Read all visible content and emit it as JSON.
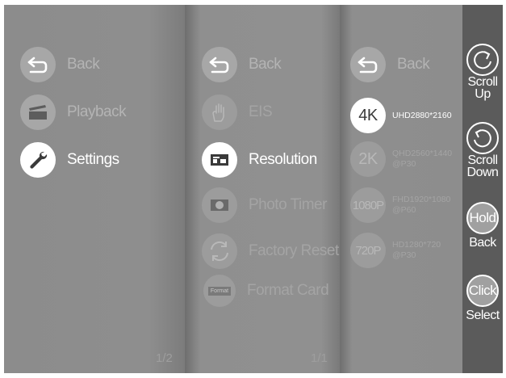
{
  "panel1": {
    "items": [
      {
        "label": "Back",
        "icon": "back-arrow-icon"
      },
      {
        "label": "Playback",
        "icon": "folder-icon"
      },
      {
        "label": "Settings",
        "icon": "wrench-icon"
      }
    ],
    "page": "1/2"
  },
  "panel2": {
    "items": [
      {
        "label": "Back",
        "icon": "back-arrow-icon"
      },
      {
        "label": "EIS",
        "icon": "hand-shake-icon"
      },
      {
        "label": "Resolution",
        "icon": "resolution-icon"
      },
      {
        "label": "Photo Timer",
        "icon": "camera-timer-icon"
      },
      {
        "label": "Factory Reset",
        "icon": "reset-arrows-icon"
      },
      {
        "label": "Format Card",
        "icon_text": "Format",
        "icon": "format-icon"
      }
    ],
    "page": "1/1"
  },
  "panel3": {
    "back": "Back",
    "options": [
      {
        "badge": "4K",
        "line1": "UHD2880*2160",
        "line2": ""
      },
      {
        "badge": "2K",
        "line1": "QHD2560*1440",
        "line2": "@P30"
      },
      {
        "badge": "1080P",
        "line1": "FHD1920*1080",
        "line2": "@P60"
      },
      {
        "badge": "720P",
        "line1": "HD1280*720",
        "line2": "@P30"
      }
    ]
  },
  "sidebar": {
    "scroll_up": [
      "Scroll",
      "Up"
    ],
    "scroll_down": [
      "Scroll",
      "Down"
    ],
    "hold": "Hold",
    "hold_label": "Back",
    "click": "Click",
    "click_label": "Select"
  },
  "colors": {
    "selected": "#ffffff",
    "dim": "#b4b4b4",
    "sidebar_bg": "#5b5b5b",
    "screen_bg": "#8a8a8a"
  }
}
